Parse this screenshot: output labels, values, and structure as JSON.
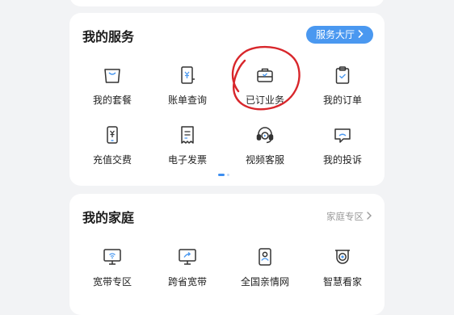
{
  "services": {
    "title": "我的服务",
    "hall_button": "服务大厅",
    "items": [
      {
        "label": "我的套餐",
        "icon": "shopping-bag-icon"
      },
      {
        "label": "账单查询",
        "icon": "bill-icon"
      },
      {
        "label": "已订业务",
        "icon": "briefcase-icon"
      },
      {
        "label": "我的订单",
        "icon": "clipboard-check-icon"
      },
      {
        "label": "充值交费",
        "icon": "phone-yen-icon"
      },
      {
        "label": "电子发票",
        "icon": "receipt-icon"
      },
      {
        "label": "视频客服",
        "icon": "headset-icon"
      },
      {
        "label": "我的投诉",
        "icon": "complaint-message-icon"
      }
    ]
  },
  "family": {
    "title": "我的家庭",
    "zone_link": "家庭专区",
    "items": [
      {
        "label": "宽带专区",
        "icon": "broadband-monitor-icon"
      },
      {
        "label": "跨省宽带",
        "icon": "cross-province-broadband-icon"
      },
      {
        "label": "全国亲情网",
        "icon": "family-network-icon"
      },
      {
        "label": "智慧看家",
        "icon": "security-camera-icon"
      }
    ]
  },
  "colors": {
    "accent": "#4a98f0",
    "icon": "#333333",
    "annotation": "#d8262b"
  }
}
